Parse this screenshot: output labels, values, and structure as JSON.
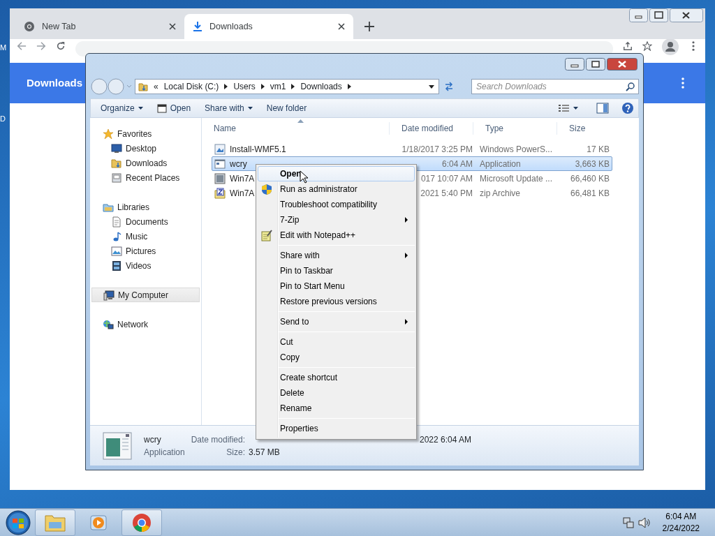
{
  "desktop": {
    "icon_labels": [
      "M",
      "D"
    ]
  },
  "browser": {
    "tabs": [
      {
        "title": "New Tab",
        "selected": false
      },
      {
        "title": "Downloads",
        "selected": true
      }
    ],
    "page_title": "Downloads"
  },
  "explorer": {
    "breadcrumb": [
      "«",
      "Local Disk (C:)",
      "Users",
      "vm1",
      "Downloads"
    ],
    "search": {
      "placeholder": "Search Downloads"
    },
    "commands": [
      {
        "label": "Organize",
        "dropdown": true
      },
      {
        "label": "Open",
        "dropdown": false
      },
      {
        "label": "Share with",
        "dropdown": true
      },
      {
        "label": "New folder",
        "dropdown": false
      }
    ],
    "nav": [
      {
        "label": "Favorites",
        "selected": false,
        "children": [
          {
            "label": "Desktop",
            "selected": false
          },
          {
            "label": "Downloads",
            "selected": false
          },
          {
            "label": "Recent Places",
            "selected": false
          }
        ]
      },
      {
        "label": "Libraries",
        "selected": false,
        "children": [
          {
            "label": "Documents",
            "selected": false
          },
          {
            "label": "Music",
            "selected": false
          },
          {
            "label": "Pictures",
            "selected": false
          },
          {
            "label": "Videos",
            "selected": false
          }
        ]
      },
      {
        "label": "My Computer",
        "selected": true
      },
      {
        "label": "Network",
        "selected": false
      }
    ],
    "columns": [
      "Name",
      "Date modified",
      "Type",
      "Size"
    ],
    "rows": [
      {
        "name": "Install-WMF5.1",
        "date": "1/18/2017 3:25 PM",
        "type": "Windows PowerS...",
        "size": "17 KB",
        "selected": false
      },
      {
        "name": "wcry",
        "date": "6:04 AM",
        "type": "Application",
        "size": "3,663 KB",
        "selected": true
      },
      {
        "name": "Win7A",
        "date": "017 10:07 AM",
        "type": "Microsoft Update ...",
        "size": "66,460 KB",
        "selected": false
      },
      {
        "name": "Win7A",
        "date": "2021 5:40 PM",
        "type": "zip Archive",
        "size": "66,481 KB",
        "selected": false
      }
    ],
    "details": {
      "name": "wcry",
      "type": "Application",
      "modified_label": "Date modified:",
      "size_label": "Size:",
      "size": "3.57 MB",
      "created": "2022 6:04 AM"
    }
  },
  "context_menu": [
    [
      {
        "label": "Open",
        "default": true,
        "submenu": false,
        "selected": true
      },
      {
        "label": "Run as administrator",
        "default": false,
        "submenu": false,
        "selected": false
      },
      {
        "label": "Troubleshoot compatibility",
        "default": false,
        "submenu": false,
        "selected": false
      },
      {
        "label": "7-Zip",
        "default": false,
        "submenu": true,
        "selected": false
      },
      {
        "label": "Edit with Notepad++",
        "default": false,
        "submenu": false,
        "selected": false
      }
    ],
    [
      {
        "label": "Share with",
        "default": false,
        "submenu": true,
        "selected": false
      },
      {
        "label": "Pin to Taskbar",
        "default": false,
        "submenu": false,
        "selected": false
      },
      {
        "label": "Pin to Start Menu",
        "default": false,
        "submenu": false,
        "selected": false
      },
      {
        "label": "Restore previous versions",
        "default": false,
        "submenu": false,
        "selected": false
      }
    ],
    [
      {
        "label": "Send to",
        "default": false,
        "submenu": true,
        "selected": false
      }
    ],
    [
      {
        "label": "Cut",
        "default": false,
        "submenu": false,
        "selected": false
      },
      {
        "label": "Copy",
        "default": false,
        "submenu": false,
        "selected": false
      }
    ],
    [
      {
        "label": "Create shortcut",
        "default": false,
        "submenu": false,
        "selected": false
      },
      {
        "label": "Delete",
        "default": false,
        "submenu": false,
        "selected": false
      },
      {
        "label": "Rename",
        "default": false,
        "submenu": false,
        "selected": false
      }
    ],
    [
      {
        "label": "Properties",
        "default": false,
        "submenu": false,
        "selected": false
      }
    ]
  ],
  "taskbar": {
    "time": "6:04 AM",
    "date": "2/24/2022"
  }
}
